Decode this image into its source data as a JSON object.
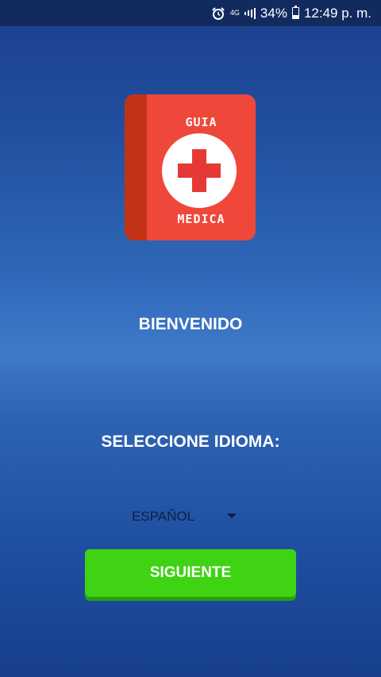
{
  "status_bar": {
    "network": "4G",
    "battery": "34%",
    "battery_level": 0.34,
    "time": "12:49 p. m.",
    "alarm_icon": "alarm-clock-icon"
  },
  "logo": {
    "top_text": "GUIA",
    "bottom_text": "MEDICA",
    "colors": {
      "cover": "#f0473b",
      "spine": "#c23316",
      "cross": "#e53935"
    }
  },
  "welcome": {
    "text": "BIENVENIDO"
  },
  "language": {
    "label": "SELECCIONE IDIOMA:",
    "selected": "ESPAÑOL"
  },
  "buttons": {
    "next": "SIGUIENTE"
  },
  "colors": {
    "background": "#2a5aab",
    "button": "#3fd313"
  }
}
